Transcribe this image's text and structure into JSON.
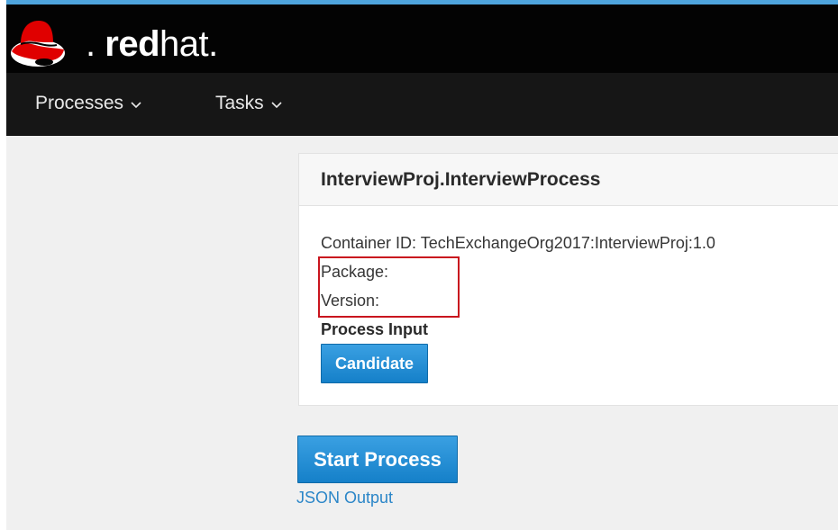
{
  "header": {
    "logo_bold": "red",
    "logo_light": "hat",
    "logo_dot": ".",
    "accent_color": "#4ea4dd",
    "logo_color": "#e00000",
    "logo_icon": "redhat-shadowman-icon"
  },
  "nav": {
    "items": [
      {
        "label": "Processes"
      },
      {
        "label": "Tasks"
      }
    ]
  },
  "card": {
    "title": "InterviewProj.InterviewProcess",
    "container_id": "Container ID: TechExchangeOrg2017:InterviewProj:1.0",
    "package": "Package:",
    "version": "Version:",
    "section_label": "Process Input",
    "candidate_button": "Candidate"
  },
  "actions": {
    "start_process": "Start Process",
    "json_output": "JSON Output"
  },
  "colors": {
    "button": "#1b89d0",
    "link": "#2b86c8",
    "highlight": "#c9151e"
  }
}
